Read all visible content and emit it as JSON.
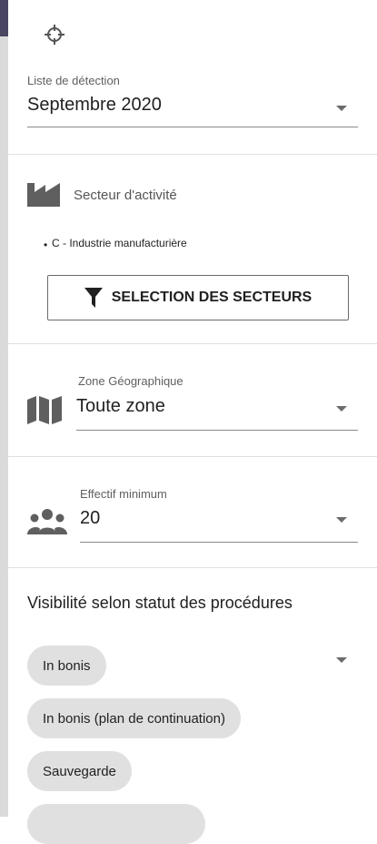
{
  "detection": {
    "label": "Liste de détection",
    "value": "Septembre 2020"
  },
  "sector": {
    "title": "Secteur d'activité",
    "items": [
      "C - Industrie manufacturière"
    ],
    "button_label": "SELECTION DES SECTEURS"
  },
  "zone": {
    "label": "Zone Géographique",
    "value": "Toute zone"
  },
  "effectif": {
    "label": "Effectif minimum",
    "value": "20"
  },
  "visibility": {
    "title": "Visibilité selon statut des procédures",
    "chips": [
      "In bonis",
      "In bonis (plan de continuation)",
      "Sauvegarde",
      ""
    ]
  },
  "icons": {
    "crosshair": "crosshair-icon",
    "factory": "factory-icon",
    "filter": "filter-icon",
    "map": "map-icon",
    "users": "users-icon",
    "dropdown": "chevron-down-icon"
  },
  "colors": {
    "icon": "#5f5f5f",
    "chip_bg": "#e0e0e0",
    "divider": "#e0e0e0"
  }
}
